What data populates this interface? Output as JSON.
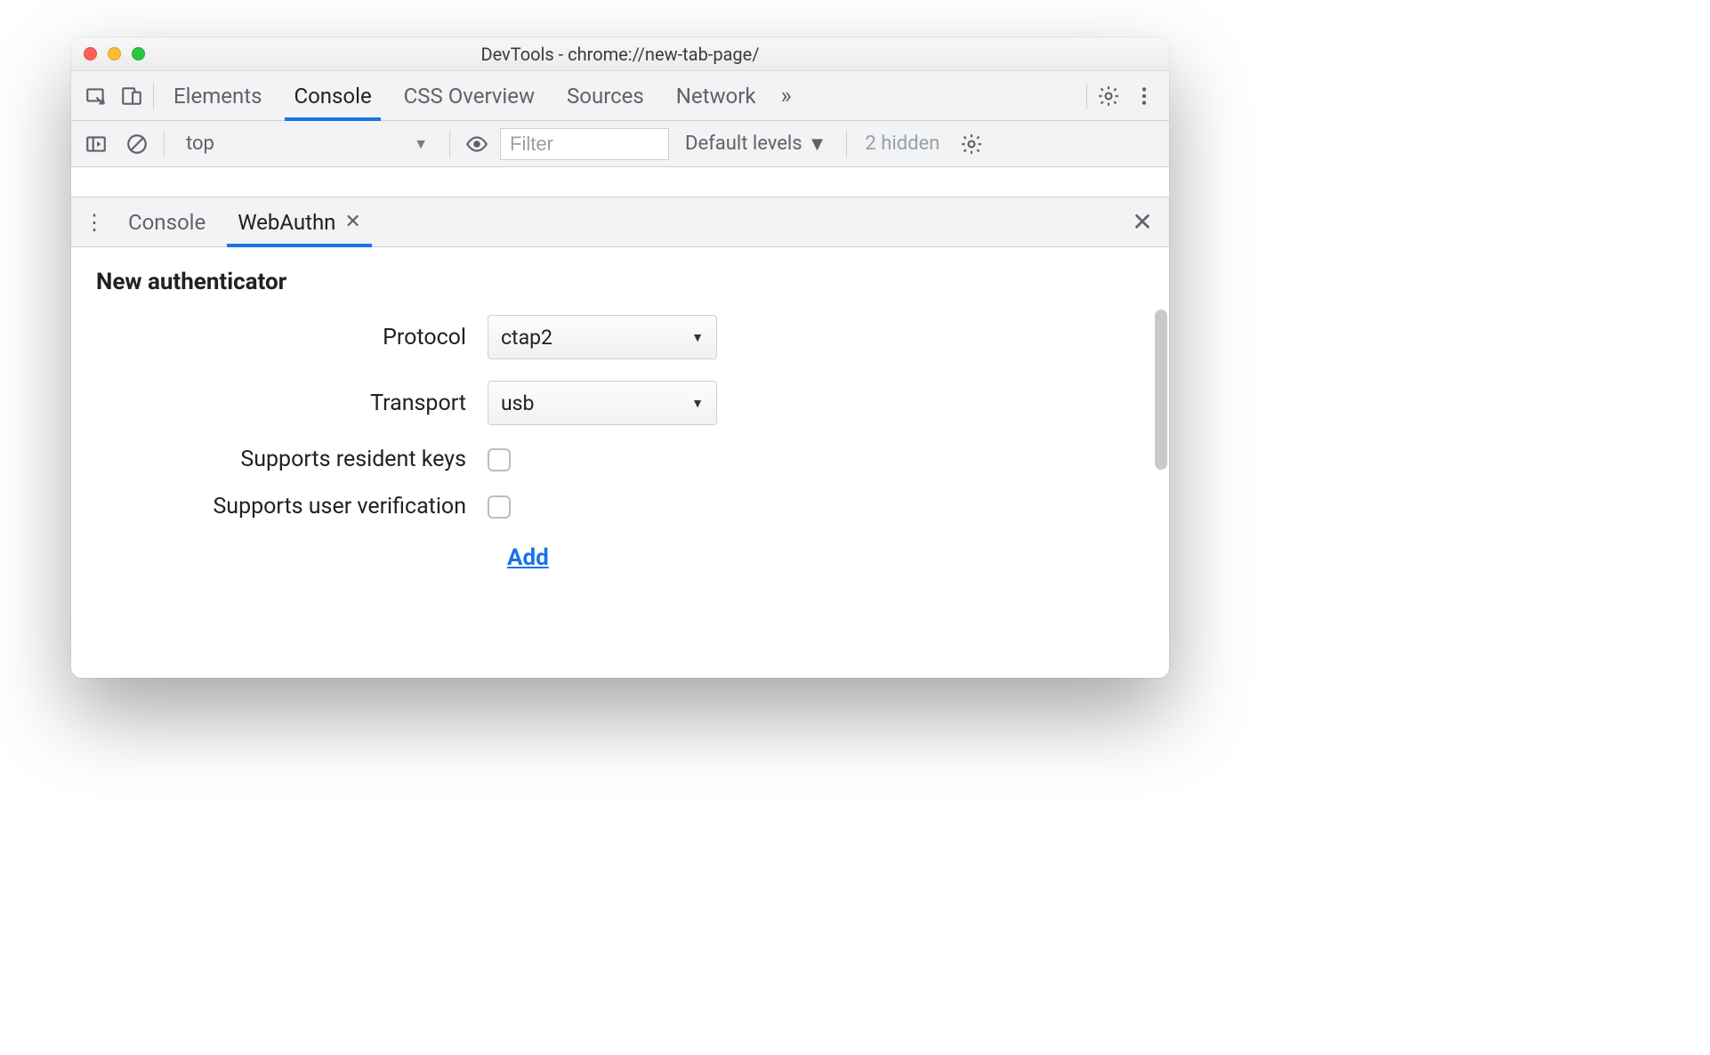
{
  "titlebar": {
    "title": "DevTools - chrome://new-tab-page/"
  },
  "tabs": {
    "items": [
      "Elements",
      "Console",
      "CSS Overview",
      "Sources",
      "Network"
    ],
    "activeIndex": 1
  },
  "consoleToolbar": {
    "context": "top",
    "filterPlaceholder": "Filter",
    "levels": "Default levels",
    "hidden": "2 hidden"
  },
  "drawer": {
    "tabs": [
      "Console",
      "WebAuthn"
    ],
    "activeIndex": 1
  },
  "webauthn": {
    "sectionTitle": "New authenticator",
    "labels": {
      "protocol": "Protocol",
      "transport": "Transport",
      "residentKeys": "Supports resident keys",
      "userVerification": "Supports user verification"
    },
    "values": {
      "protocol": "ctap2",
      "transport": "usb",
      "residentKeys": false,
      "userVerification": false
    },
    "addLabel": "Add"
  }
}
